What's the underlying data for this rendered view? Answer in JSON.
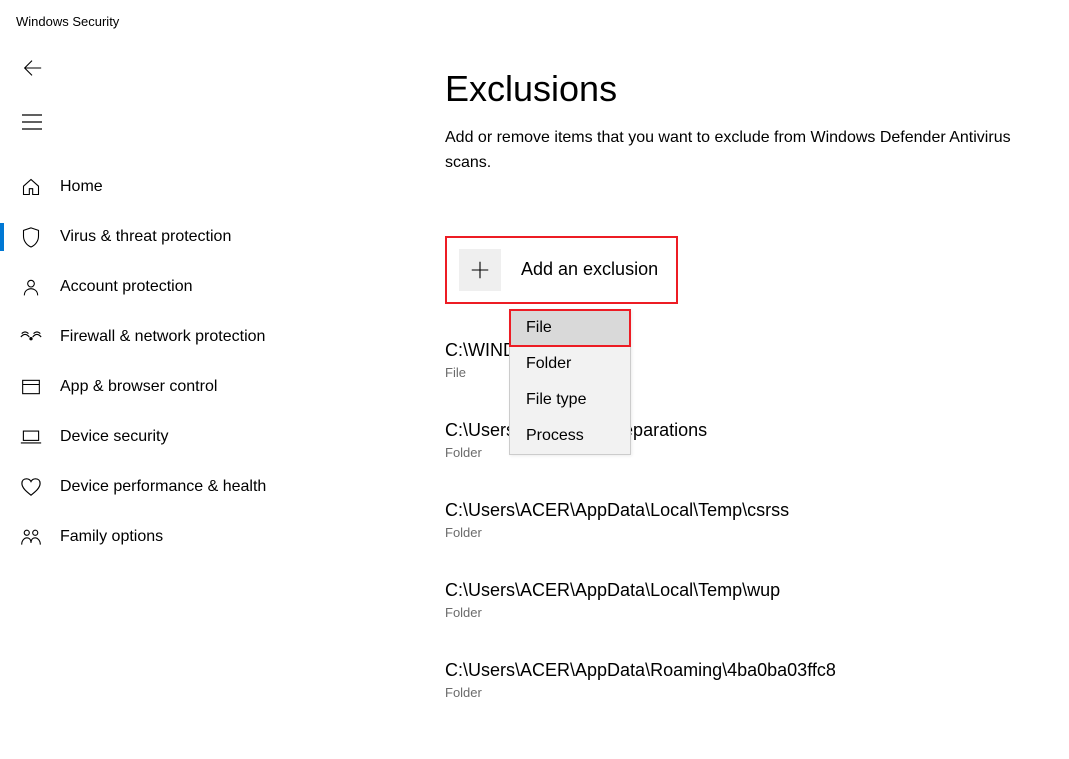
{
  "app_title": "Windows Security",
  "sidebar": {
    "items": [
      {
        "label": "Home",
        "icon": "home-icon"
      },
      {
        "label": "Virus & threat protection",
        "icon": "shield-icon"
      },
      {
        "label": "Account protection",
        "icon": "person-icon"
      },
      {
        "label": "Firewall & network protection",
        "icon": "signal-icon"
      },
      {
        "label": "App & browser control",
        "icon": "browser-icon"
      },
      {
        "label": "Device security",
        "icon": "laptop-icon"
      },
      {
        "label": "Device performance & health",
        "icon": "heart-icon"
      },
      {
        "label": "Family options",
        "icon": "family-icon"
      }
    ],
    "active_index": 1
  },
  "main": {
    "title": "Exclusions",
    "description": "Add or remove items that you want to exclude from Windows Defender Antivirus scans.",
    "add_button_label": "Add an exclusion",
    "dropdown": {
      "options": [
        "File",
        "Folder",
        "File type",
        "Process"
      ],
      "hover_index": 0
    },
    "exclusions": [
      {
        "path": "C:\\WIND                              nder.exe",
        "type": "File"
      },
      {
        "path": "C:\\Users\\                              Celemony\\Separations",
        "type": "Folder"
      },
      {
        "path": "C:\\Users\\ACER\\AppData\\Local\\Temp\\csrss",
        "type": "Folder"
      },
      {
        "path": "C:\\Users\\ACER\\AppData\\Local\\Temp\\wup",
        "type": "Folder"
      },
      {
        "path": "C:\\Users\\ACER\\AppData\\Roaming\\4ba0ba03ffc8",
        "type": "Folder"
      }
    ]
  },
  "highlight_color": "#ed1c24"
}
